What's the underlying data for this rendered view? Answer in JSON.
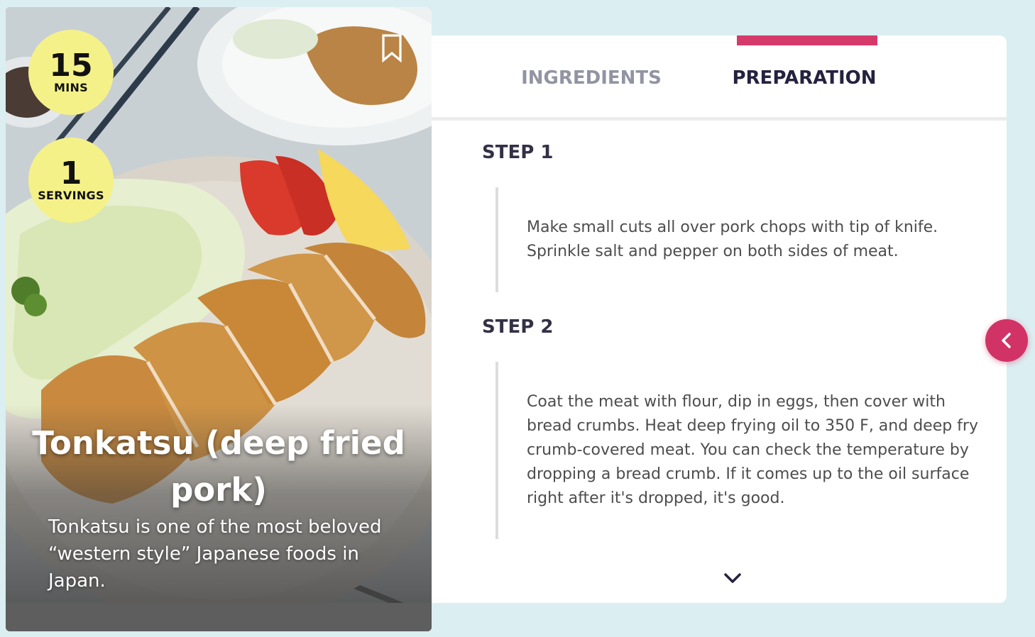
{
  "recipe": {
    "time_value": "15",
    "time_unit": "MINS",
    "servings_value": "1",
    "servings_unit": "SERVINGS",
    "title": "Tonkatsu (deep fried pork)",
    "description": "Tonkatsu is one of the most beloved “western style” Japanese foods in Japan.",
    "image_subject": "tonkatsu-photo"
  },
  "tabs": [
    {
      "label": "INGREDIENTS",
      "active": false
    },
    {
      "label": "PREPARATION",
      "active": true
    }
  ],
  "steps": [
    {
      "title": "STEP 1",
      "text": "Make small cuts all over pork chops with tip of knife. Sprinkle salt and pepper on both sides of meat."
    },
    {
      "title": "STEP 2",
      "text": "Coat the meat with flour, dip in eggs, then cover with bread crumbs. Heat deep frying oil to 350 F, and deep fry crumb-covered meat. You can check the temperature by dropping a bread crumb. If it comes up to the oil surface right after it's dropped, it's good."
    }
  ],
  "colors": {
    "accent": "#d63a6b",
    "badge": "#f5f189",
    "page_background": "#dbeef1",
    "tab_active": "#25223f",
    "tab_inactive": "#9294a3"
  },
  "icons": {
    "bookmark": "bookmark-icon",
    "scroll_down": "chevron-down-icon",
    "collapse": "chevron-left-icon"
  }
}
